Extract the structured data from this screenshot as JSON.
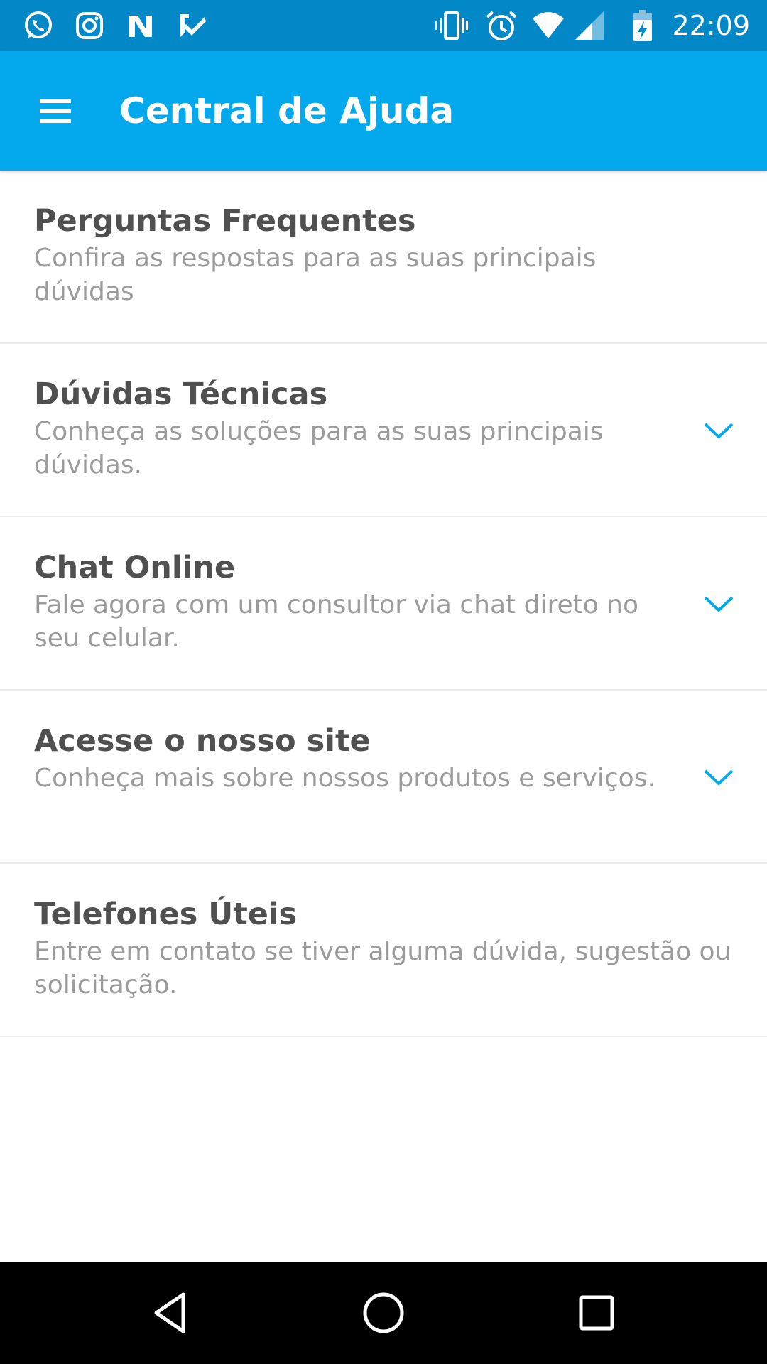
{
  "status_bar": {
    "time": "22:09",
    "left_icons": [
      "whatsapp-icon",
      "instagram-icon",
      "nubank-icon",
      "tasks-icon"
    ],
    "right_icons": [
      "vibrate-icon",
      "alarm-icon",
      "wifi-icon",
      "signal-icon",
      "battery-charging-icon"
    ]
  },
  "app_bar": {
    "title": "Central de Ajuda",
    "menu_icon": "hamburger-menu-icon"
  },
  "items": [
    {
      "title": "Perguntas Frequentes",
      "description": "Confira as respostas para as suas principais dúvidas",
      "expandable": false
    },
    {
      "title": "Dúvidas Técnicas",
      "description": "Conheça as soluções para as suas principais dúvidas.",
      "expandable": true
    },
    {
      "title": "Chat Online",
      "description": "Fale agora com um consultor via chat direto no seu celular.",
      "expandable": true
    },
    {
      "title": "Acesse o nosso site",
      "description": "Conheça mais sobre nossos produtos e serviços.",
      "expandable": true
    },
    {
      "title": "Telefones Úteis",
      "description": "Entre em contato se tiver alguma dúvida, sugestão ou solicitação.",
      "expandable": false
    }
  ],
  "nav_bar": {
    "buttons": [
      "back-icon",
      "home-icon",
      "recents-icon"
    ]
  },
  "colors": {
    "status_bar": "#0288c7",
    "app_bar": "#03a9ec",
    "accent": "#03a9ec",
    "title_text": "#505050",
    "description_text": "#9b9b9b"
  }
}
